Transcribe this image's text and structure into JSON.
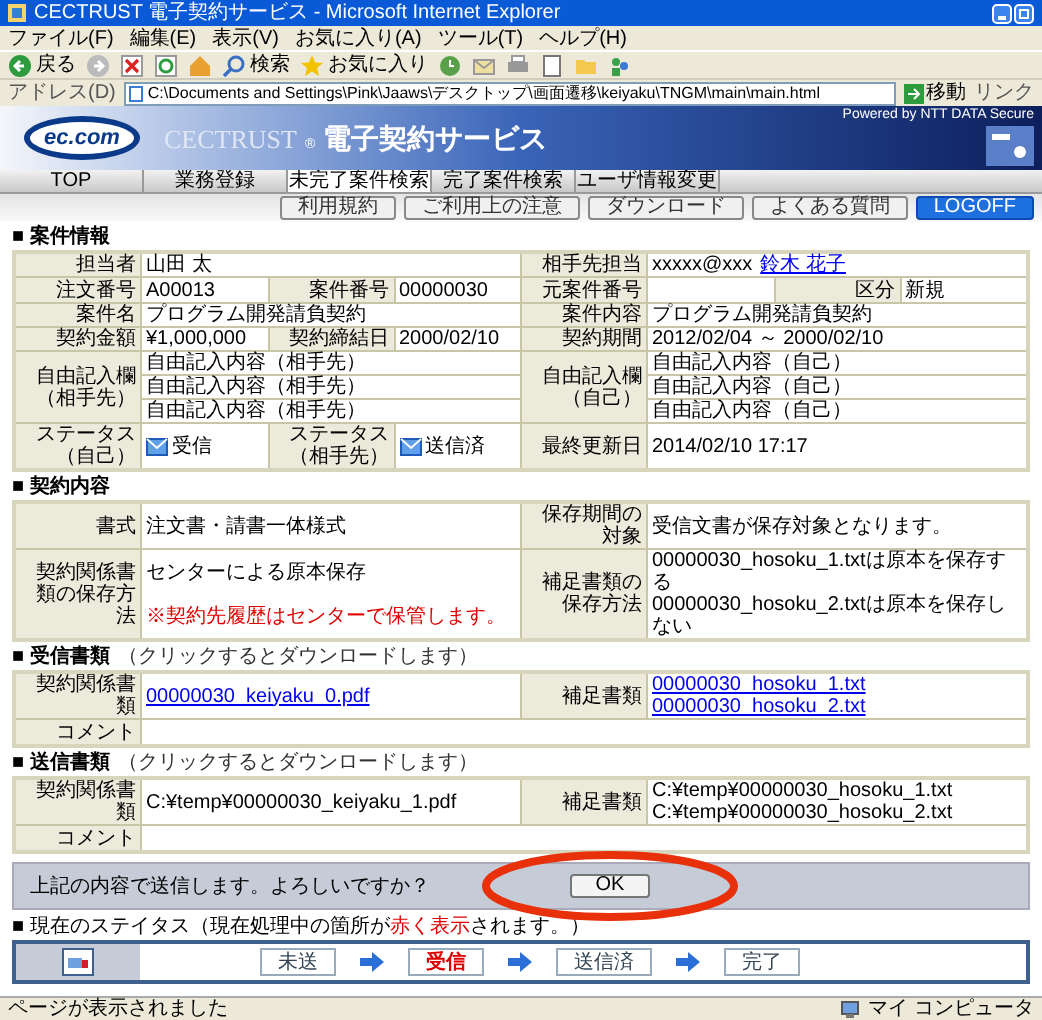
{
  "window": {
    "title": "CECTRUST 電子契約サービス - Microsoft Internet Explorer"
  },
  "menu": [
    "ファイル(F)",
    "編集(E)",
    "表示(V)",
    "お気に入り(A)",
    "ツール(T)",
    "ヘルプ(H)"
  ],
  "toolbar": [
    {
      "kind": "back",
      "text": "戻る"
    },
    {
      "kind": "forward"
    },
    {
      "kind": "stop"
    },
    {
      "kind": "refresh"
    },
    {
      "kind": "home"
    },
    {
      "kind": "search",
      "text": "検索"
    },
    {
      "kind": "favorites",
      "text": "お気に入り"
    },
    {
      "kind": "history"
    },
    {
      "kind": "mail"
    },
    {
      "kind": "print"
    },
    {
      "kind": "edit"
    },
    {
      "kind": "folder"
    },
    {
      "kind": "messenger"
    }
  ],
  "address": {
    "label": "アドレス(D)",
    "url": "C:\\Documents and Settings\\Pink\\Jaaws\\デスクトップ\\画面遷移\\keiyaku\\TNGM\\main\\main.html",
    "go": "移動",
    "links": "リンク"
  },
  "banner": {
    "logo": "ec.com",
    "brand": "CECTRUST",
    "mark": "®",
    "service": "電子契約サービス",
    "powered": "Powered by NTT DATA Secure"
  },
  "nav_tabs": [
    {
      "label": "TOP",
      "selected": false
    },
    {
      "label": "業務登録",
      "selected": false
    },
    {
      "label": "未完了案件検索",
      "selected": true
    },
    {
      "label": "完了案件検索",
      "selected": false
    },
    {
      "label": "ユーザ情報変更",
      "selected": false
    }
  ],
  "utility_buttons": [
    {
      "label": "利用規約",
      "kind": "normal"
    },
    {
      "label": "ご利用上の注意",
      "kind": "normal"
    },
    {
      "label": "ダウンロード",
      "kind": "normal"
    },
    {
      "label": "よくある質問",
      "kind": "normal"
    },
    {
      "label": "LOGOFF",
      "kind": "logoff"
    }
  ],
  "sections": [
    {
      "title": "■ 案件情報",
      "rows": [
        {
          "left": [
            {
              "label": "担当者",
              "lines": [
                [
                  {
                    "kind": "text",
                    "text": "山田 太"
                  }
                ]
              ]
            }
          ],
          "right": [
            {
              "label": "相手先担当",
              "lines": [
                [
                  {
                    "kind": "text",
                    "text": "xxxxx@xxx"
                  },
                  {
                    "kind": "link",
                    "text": "鈴木 花子"
                  }
                ]
              ]
            }
          ]
        },
        {
          "left": [
            {
              "label": "注文番号",
              "lines": [
                [
                  {
                    "kind": "text",
                    "text": "A00013"
                  }
                ]
              ]
            },
            {
              "label": "案件番号",
              "lines": [
                [
                  {
                    "kind": "text",
                    "text": "00000030"
                  }
                ]
              ]
            }
          ],
          "right": [
            {
              "label": "元案件番号"
            },
            {
              "label": "区分",
              "lines": [
                [
                  {
                    "kind": "text",
                    "text": "新規"
                  }
                ]
              ]
            }
          ]
        },
        {
          "left": [
            {
              "label": "案件名",
              "lines": [
                [
                  {
                    "kind": "text",
                    "text": "プログラム開発請負契約"
                  }
                ]
              ]
            }
          ],
          "right": [
            {
              "label": "案件内容",
              "lines": [
                [
                  {
                    "kind": "text",
                    "text": "プログラム開発請負契約"
                  }
                ]
              ]
            }
          ]
        },
        {
          "left": [
            {
              "label": "契約金額",
              "lines": [
                [
                  {
                    "kind": "text",
                    "text": "¥1,000,000"
                  }
                ]
              ]
            },
            {
              "label": "契約締結日",
              "lines": [
                [
                  {
                    "kind": "text",
                    "text": "2000/02/10"
                  }
                ]
              ]
            }
          ],
          "right": [
            {
              "label": "契約期間",
              "lines": [
                [
                  {
                    "kind": "text",
                    "text": "2012/02/04 ～ 2000/02/10"
                  }
                ]
              ]
            }
          ]
        },
        {
          "left": [
            {
              "label": "自由記入欄（相手先）",
              "divided": true,
              "lines": [
                [
                  {
                    "kind": "text",
                    "text": "自由記入内容（相手先）"
                  }
                ],
                [
                  {
                    "kind": "text",
                    "text": "自由記入内容（相手先）"
                  }
                ],
                [
                  {
                    "kind": "text",
                    "text": "自由記入内容（相手先）"
                  }
                ]
              ]
            }
          ],
          "right": [
            {
              "label": "自由記入欄（自己）",
              "divided": true,
              "lines": [
                [
                  {
                    "kind": "text",
                    "text": "自由記入内容（自己）"
                  }
                ],
                [
                  {
                    "kind": "text",
                    "text": "自由記入内容（自己）"
                  }
                ],
                [
                  {
                    "kind": "text",
                    "text": "自由記入内容（自己）"
                  }
                ]
              ]
            }
          ]
        },
        {
          "left": [
            {
              "label": "ステータス（自己）",
              "lines": [
                [
                  {
                    "kind": "status",
                    "text": "受信"
                  }
                ]
              ]
            },
            {
              "label": "ステータス（相手先）",
              "lines": [
                [
                  {
                    "kind": "status",
                    "text": "送信済"
                  }
                ]
              ]
            }
          ],
          "right": [
            {
              "label": "最終更新日",
              "lines": [
                [
                  {
                    "kind": "text",
                    "text": "2014/02/10 17:17"
                  }
                ]
              ]
            }
          ]
        }
      ]
    },
    {
      "title": "■ 契約内容",
      "rows": [
        {
          "left": [
            {
              "label": "書式",
              "lines": [
                [
                  {
                    "kind": "text",
                    "text": "注文書・請書一体様式"
                  }
                ]
              ]
            }
          ],
          "right": [
            {
              "label": "保存期間の対象",
              "lines": [
                [
                  {
                    "kind": "text",
                    "text": "受信文書が保存対象となります。"
                  }
                ]
              ]
            }
          ]
        },
        {
          "left": [
            {
              "label": "契約関係書類の保存方法",
              "lines": [
                [
                  {
                    "kind": "text",
                    "text": "センターによる原本保存"
                  }
                ],
                [
                  {
                    "kind": "note",
                    "text": "※契約先履歴はセンターで保管します。"
                  }
                ]
              ]
            }
          ],
          "right": [
            {
              "label": "補足書類の保存方法",
              "lines": [
                [
                  {
                    "kind": "text",
                    "text": "00000030_hosoku_1.txtは原本を保存する"
                  }
                ],
                [
                  {
                    "kind": "text",
                    "text": "00000030_hosoku_2.txtは原本を保存しない"
                  }
                ]
              ]
            }
          ]
        }
      ]
    },
    {
      "title": "■ 受信書類",
      "note": "（クリックするとダウンロードします）",
      "rows": [
        {
          "left": [
            {
              "label": "契約関係書類",
              "lines": [
                [
                  {
                    "kind": "link",
                    "text": "00000030_keiyaku_0.pdf"
                  }
                ]
              ]
            }
          ],
          "right": [
            {
              "label": "補足書類",
              "lines": [
                [
                  {
                    "kind": "link",
                    "text": "00000030_hosoku_1.txt"
                  }
                ],
                [
                  {
                    "kind": "link",
                    "text": "00000030_hosoku_2.txt"
                  }
                ]
              ]
            }
          ]
        },
        {
          "full": {
            "label": "コメント"
          }
        }
      ]
    },
    {
      "title": "■ 送信書類",
      "note": "（クリックするとダウンロードします）",
      "rows": [
        {
          "left": [
            {
              "label": "契約関係書類",
              "lines": [
                [
                  {
                    "kind": "text",
                    "text": "C:¥temp¥00000030_keiyaku_1.pdf"
                  }
                ]
              ]
            }
          ],
          "right": [
            {
              "label": "補足書類",
              "lines": [
                [
                  {
                    "kind": "text",
                    "text": "C:¥temp¥00000030_hosoku_1.txt"
                  }
                ],
                [
                  {
                    "kind": "text",
                    "text": "C:¥temp¥00000030_hosoku_2.txt"
                  }
                ]
              ]
            }
          ]
        },
        {
          "full": {
            "label": "コメント"
          }
        }
      ]
    }
  ],
  "confirm": {
    "message": "上記の内容で送信します。よろしいですか？",
    "button": "OK"
  },
  "progress": {
    "title": [
      {
        "kind": "normal",
        "text": "■ 現在のステイタス（現在処理中の箇所が"
      },
      {
        "kind": "highlight",
        "text": "赤く表示"
      },
      {
        "kind": "normal",
        "text": "されます。）"
      }
    ],
    "steps": [
      {
        "label": "未送",
        "current": false
      },
      {
        "label": "受信",
        "current": true
      },
      {
        "label": "送信済",
        "current": false
      },
      {
        "label": "完了",
        "current": false
      }
    ]
  },
  "status_bar": {
    "message": "ページが表示されました",
    "zone": "マイ コンピュータ"
  }
}
